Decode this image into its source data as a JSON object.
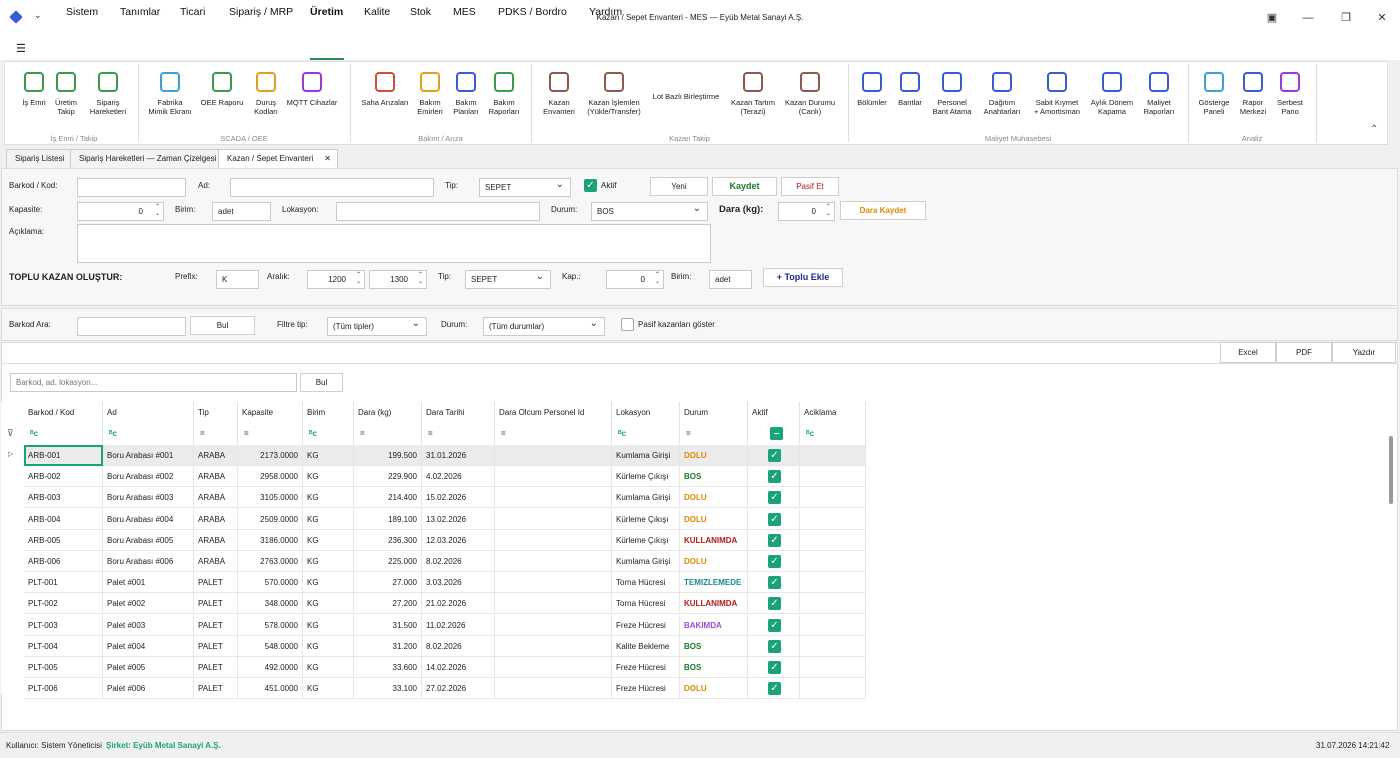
{
  "window": {
    "title": "Kazan / Sepet Envanteri - MES — Eyüb Metal Sanayi A.Ş.",
    "min": "—",
    "max": "❐",
    "close": "✕",
    "restore": "▣"
  },
  "menu": [
    "Sistem",
    "Tanımlar",
    "Ticari",
    "Sipariş / MRP",
    "Üretim",
    "Kalite",
    "Stok",
    "MES",
    "PDKS / Bordro",
    "Yardım"
  ],
  "ribbon": {
    "buttons": [
      {
        "l1": "İş Emri",
        "l2": "",
        "color": "#3a9b4d"
      },
      {
        "l1": "Üretim",
        "l2": "Takip",
        "color": "#3a9b4d"
      },
      {
        "l1": "Sipariş",
        "l2": "Hareketleri",
        "color": "#3a9b4d"
      },
      {
        "l1": "Fabrika",
        "l2": "Mimik Ekranı",
        "color": "#3aa0d8"
      },
      {
        "l1": "OEE Raporu",
        "l2": "",
        "color": "#3a9b4d"
      },
      {
        "l1": "Duruş",
        "l2": "Kodları",
        "color": "#e0a020"
      },
      {
        "l1": "MQTT Cihazlar",
        "l2": "",
        "color": "#9b3ad8"
      },
      {
        "l1": "Saha Arızaları",
        "l2": "",
        "color": "#d84a3a"
      },
      {
        "l1": "Bakım",
        "l2": "Emirleri",
        "color": "#e0a020"
      },
      {
        "l1": "Bakım",
        "l2": "Planları",
        "color": "#3a5ad8"
      },
      {
        "l1": "Bakım",
        "l2": "Raporları",
        "color": "#3a9b4d"
      },
      {
        "l1": "Kazan",
        "l2": "Envanteri",
        "color": "#8a5a4a"
      },
      {
        "l1": "Kazan İşlemleri",
        "l2": "(Yükle/Transfer)",
        "color": "#8a5a4a"
      },
      {
        "l1": "Lot Bazlı Birleştirme",
        "l2": "",
        "color": "#ffffff"
      },
      {
        "l1": "Kazan Tartım",
        "l2": "(Terazi)",
        "color": "#8a5a4a"
      },
      {
        "l1": "Kazan Durumu",
        "l2": "(Canlı)",
        "color": "#8a5a4a"
      },
      {
        "l1": "Bölümler",
        "l2": "",
        "color": "#3a5ad8"
      },
      {
        "l1": "Bantlar",
        "l2": "",
        "color": "#3a5ad8"
      },
      {
        "l1": "Personel",
        "l2": "Bant Atama",
        "color": "#3a5ad8"
      },
      {
        "l1": "Dağıtım",
        "l2": "Anahtarları",
        "color": "#3a5ad8"
      },
      {
        "l1": "Sabit Kıymet",
        "l2": "+ Amortisman",
        "color": "#3a5ad8"
      },
      {
        "l1": "Aylık Dönem",
        "l2": "Kapama",
        "color": "#3a5ad8"
      },
      {
        "l1": "Maliyet",
        "l2": "Raporları",
        "color": "#3a5ad8"
      },
      {
        "l1": "Gösterge",
        "l2": "Paneli",
        "color": "#3aa0d8"
      },
      {
        "l1": "Rapor",
        "l2": "Merkezi",
        "color": "#3a5ad8"
      },
      {
        "l1": "Serbest",
        "l2": "Pano",
        "color": "#9b3ad8"
      }
    ],
    "groups": [
      "İş Emri / Takip",
      "SCADA / OEE",
      "Bakım / Arıza",
      "Kazan Takip",
      "Maliyet Muhasebesi",
      "Analiz"
    ]
  },
  "tabs": [
    "Sipariş Listesi",
    "Sipariş Hareketleri — Zaman Çizelgesi",
    "Kazan / Sepet Envanteri"
  ],
  "form": {
    "barkod_lbl": "Barkod / Kod:",
    "ad_lbl": "Ad:",
    "tip_lbl": "Tip:",
    "tip_val": "SEPET",
    "aktif_lbl": "Aktif",
    "yeni": "Yeni",
    "kaydet": "Kaydet",
    "pasif_et": "Pasif Et",
    "kapasite_lbl": "Kapasite:",
    "kapasite_val": "0",
    "birim_lbl": "Birim:",
    "birim_val": "adet",
    "lokasyon_lbl": "Lokasyon:",
    "durum_lbl": "Durum:",
    "durum_val": "BOS",
    "dara_lbl": "Dara (kg):",
    "dara_val": "0",
    "dara_kaydet": "Dara Kaydet",
    "aciklama_lbl": "Açıklama:",
    "toplu_lbl": "TOPLU KAZAN OLUŞTUR:",
    "prefix_lbl": "Prefix:",
    "prefix_val": "K",
    "aralik_lbl": "Aralık:",
    "aralik1": "1200",
    "aralik2": "1300",
    "tip2_lbl": "Tip:",
    "tip2_val": "SEPET",
    "kap_lbl": "Kap.:",
    "kap_val": "0",
    "birim2_lbl": "Birim:",
    "birim2_val": "adet",
    "toplu_ekle": "+ Toplu Ekle"
  },
  "filter": {
    "barkod_ara": "Barkod Ara:",
    "bul": "Bul",
    "filtre_tip": "Filtre tip:",
    "tip_val": "(Tüm tipler)",
    "durum_lbl": "Durum:",
    "durum_val": "(Tüm durumlar)",
    "pasif": "Pasif kazanları göster"
  },
  "export": {
    "excel": "Excel",
    "pdf": "PDF",
    "yazdir": "Yazdır"
  },
  "search": {
    "placeholder": "Barkod, ad, lokasyon...",
    "bul": "Bul"
  },
  "columns": [
    "Barkod / Kod",
    "Ad",
    "Tip",
    "Kapasite",
    "Birim",
    "Dara (kg)",
    "Dara Tarihi",
    "Dara Olcum Personel Id",
    "Lokasyon",
    "Durum",
    "Aktif",
    "Aciklama"
  ],
  "rows": [
    [
      "ARB-001",
      "Boru Arabası #001",
      "ARABA",
      "2173.0000",
      "KG",
      "199.500",
      "31.01.2026",
      "",
      "Kumlama Girişi",
      "DOLU"
    ],
    [
      "ARB-002",
      "Boru Arabası #002",
      "ARABA",
      "2958.0000",
      "KG",
      "229.900",
      "4.02.2026",
      "",
      "Kürleme Çıkışı",
      "BOS"
    ],
    [
      "ARB-003",
      "Boru Arabası #003",
      "ARABA",
      "3105.0000",
      "KG",
      "214.400",
      "15.02.2026",
      "",
      "Kumlama Girişi",
      "DOLU"
    ],
    [
      "ARB-004",
      "Boru Arabası #004",
      "ARABA",
      "2509.0000",
      "KG",
      "189.100",
      "13.02.2026",
      "",
      "Kürleme Çıkışı",
      "DOLU"
    ],
    [
      "ARB-005",
      "Boru Arabası #005",
      "ARABA",
      "3186.0000",
      "KG",
      "236.300",
      "12.03.2026",
      "",
      "Kürleme Çıkışı",
      "KULLANIMDA"
    ],
    [
      "ARB-006",
      "Boru Arabası #006",
      "ARABA",
      "2763.0000",
      "KG",
      "225.000",
      "8.02.2026",
      "",
      "Kumlama Girişi",
      "DOLU"
    ],
    [
      "PLT-001",
      "Palet #001",
      "PALET",
      "570.0000",
      "KG",
      "27.000",
      "3.03.2026",
      "",
      "Torna Hücresi",
      "TEMIZLEMEDE"
    ],
    [
      "PLT-002",
      "Palet #002",
      "PALET",
      "348.0000",
      "KG",
      "27.200",
      "21.02.2026",
      "",
      "Torna Hücresi",
      "KULLANIMDA"
    ],
    [
      "PLT-003",
      "Palet #003",
      "PALET",
      "578.0000",
      "KG",
      "31.500",
      "11.02.2026",
      "",
      "Freze Hücresi",
      "BAKIMDA"
    ],
    [
      "PLT-004",
      "Palet #004",
      "PALET",
      "548.0000",
      "KG",
      "31.200",
      "8.02.2026",
      "",
      "Kalite Bekleme",
      "BOS"
    ],
    [
      "PLT-005",
      "Palet #005",
      "PALET",
      "492.0000",
      "KG",
      "33.600",
      "14.02.2026",
      "",
      "Freze Hücresi",
      "BOS"
    ],
    [
      "PLT-006",
      "Palet #006",
      "PALET",
      "451.0000",
      "KG",
      "33.100",
      "27.02.2026",
      "",
      "Freze Hücresi",
      "DOLU"
    ]
  ],
  "status_colors": {
    "DOLU": "#e08a00",
    "BOS": "#1a7a2a",
    "KULLANIMDA": "#b01a1a",
    "TEMIZLEMEDE": "#1a8a9a",
    "BAKIMDA": "#9b4ad8"
  },
  "status": {
    "user": "Kullanıcı: Sistem Yöneticisi",
    "company": "Şirket: Eyüb Metal Sanayi A.Ş.",
    "datetime": "31.07.2026 14:21:42"
  }
}
